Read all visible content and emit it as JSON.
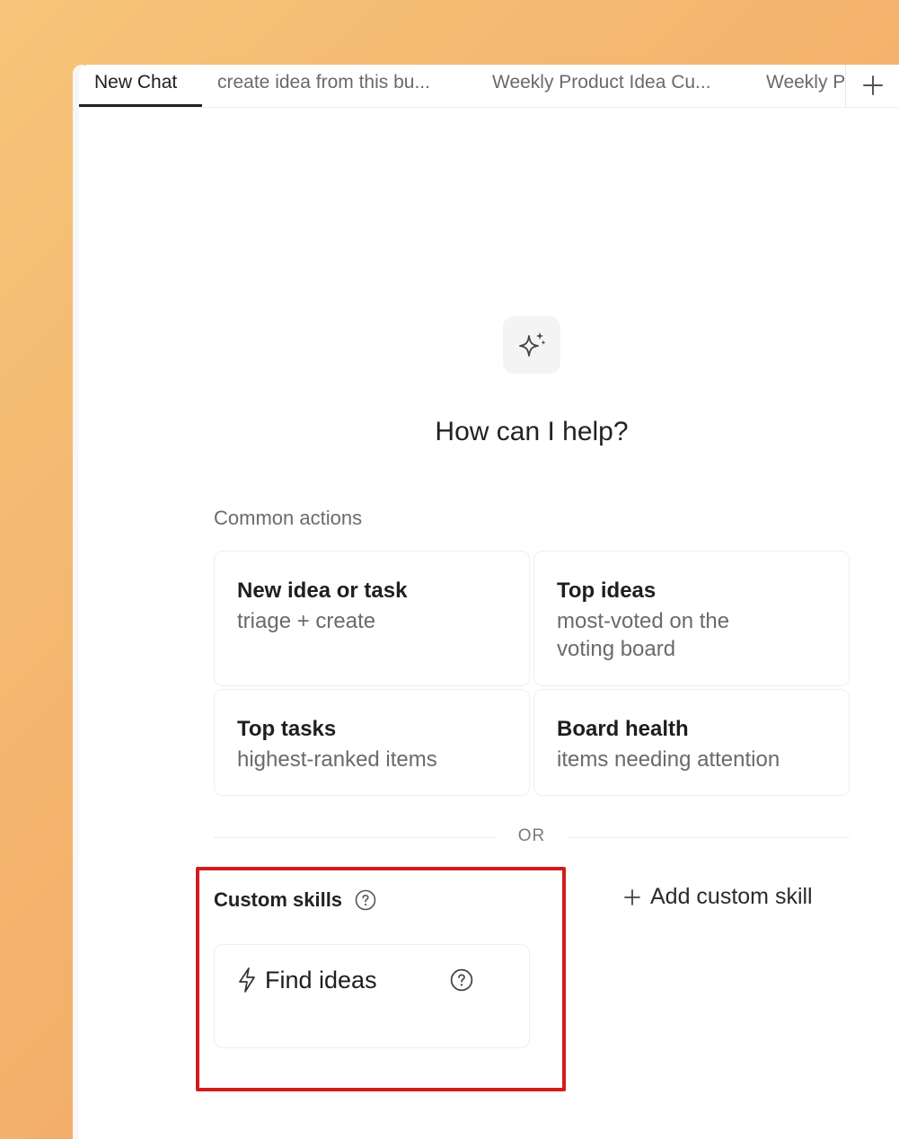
{
  "tabs": [
    {
      "label": "New Chat",
      "active": true
    },
    {
      "label": "create idea from this bu...",
      "active": false
    },
    {
      "label": "Weekly Product Idea Cu...",
      "active": false
    },
    {
      "label": "Weekly Product Idea Cu...",
      "active": false
    }
  ],
  "tab_add_icon": "plus-icon",
  "hero_icon": "sparkle-icon",
  "heading": "How can I help?",
  "common_actions": {
    "label": "Common actions",
    "cards": [
      {
        "title": "New idea or task",
        "desc": "triage + create"
      },
      {
        "title": "Top ideas",
        "desc": "most-voted on the voting board"
      },
      {
        "title": "Top tasks",
        "desc": "highest-ranked items"
      },
      {
        "title": "Board health",
        "desc": "items needing attention"
      }
    ]
  },
  "divider_text": "OR",
  "custom_skills": {
    "label": "Custom skills",
    "help_icon": "question-circle-icon",
    "add_label": "Add custom skill",
    "skills": [
      {
        "name": "Find ideas",
        "icon": "lightning-icon"
      }
    ]
  },
  "colors": {
    "highlight": "#d21c1c",
    "background_start": "#f6c478",
    "background_end": "#f1a35f"
  }
}
